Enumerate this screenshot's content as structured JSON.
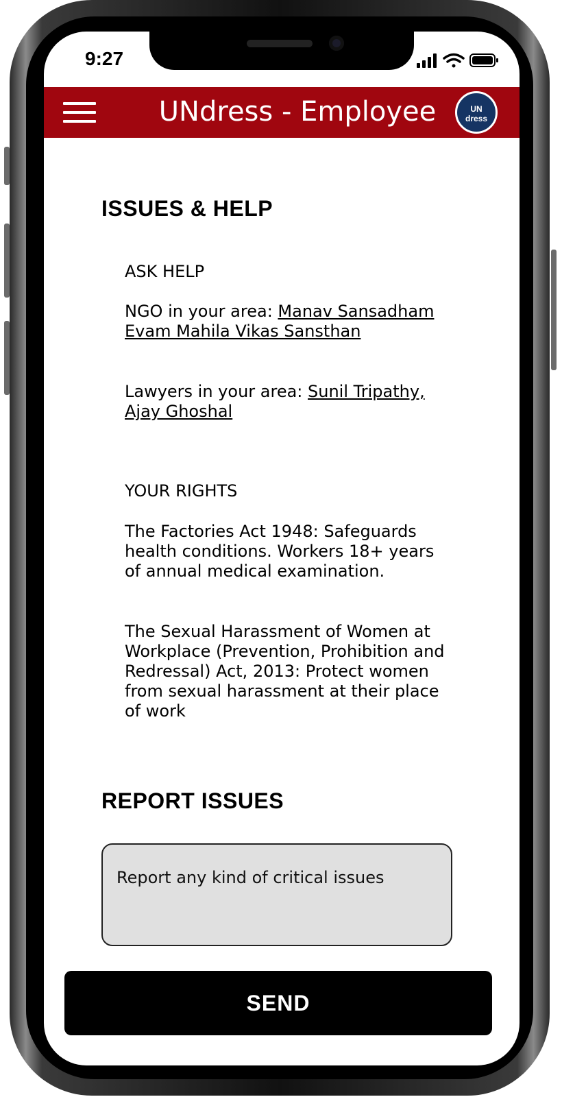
{
  "status_bar": {
    "time": "9:27"
  },
  "header": {
    "title": "UNdress - Employee",
    "logo_top": "UN",
    "logo_bottom": "dress",
    "bg_color": "#a0060f"
  },
  "issues_help": {
    "title": "ISSUES & HELP",
    "ask_help": "ASK HELP",
    "ngo_prefix": "NGO in your area: ",
    "ngo_link": "Manav Sansadham Evam Mahila Vikas Sansthan",
    "lawyers_prefix": "Lawyers in your area: ",
    "lawyers_link": "Sunil Tripathy, Ajay Ghoshal",
    "your_rights": "YOUR RIGHTS",
    "right_1": "The Factories Act 1948: Safeguards health conditions. Workers 18+ years of annual medical examination.",
    "right_2": "The Sexual Harassment of Women at Workplace (Prevention, Prohibition and Redressal) Act, 2013: Protect women from sexual harassment at their place of work"
  },
  "report": {
    "title": "REPORT ISSUES",
    "placeholder": "Report any kind of critical issues",
    "send_label": "SEND"
  }
}
